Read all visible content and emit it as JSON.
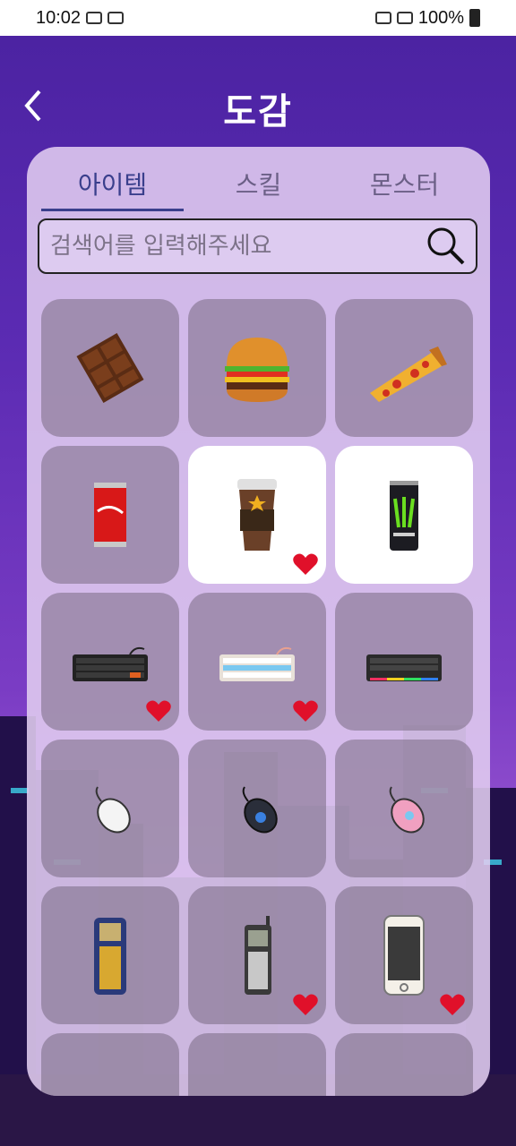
{
  "status_bar": {
    "time": "10:02",
    "battery": "100%"
  },
  "header": {
    "title": "도감",
    "back_icon": "chevron-left-icon"
  },
  "tabs": [
    {
      "label": "아이템",
      "active": true
    },
    {
      "label": "스킬",
      "active": false
    },
    {
      "label": "몬스터",
      "active": false
    }
  ],
  "search": {
    "placeholder": "검색어를 입력해주세요",
    "value": ""
  },
  "items": [
    {
      "icon": "chocolate-bar-icon",
      "owned": false,
      "favorite": false
    },
    {
      "icon": "hamburger-icon",
      "owned": false,
      "favorite": false
    },
    {
      "icon": "pizza-slice-icon",
      "owned": false,
      "favorite": false
    },
    {
      "icon": "cola-can-icon",
      "owned": false,
      "favorite": false
    },
    {
      "icon": "coffee-cup-icon",
      "owned": true,
      "favorite": true
    },
    {
      "icon": "energy-drink-can-icon",
      "owned": true,
      "favorite": false
    },
    {
      "icon": "black-keyboard-icon",
      "owned": false,
      "favorite": true
    },
    {
      "icon": "white-blue-keyboard-icon",
      "owned": false,
      "favorite": true
    },
    {
      "icon": "rgb-keyboard-icon",
      "owned": false,
      "favorite": false
    },
    {
      "icon": "white-mouse-icon",
      "owned": false,
      "favorite": false
    },
    {
      "icon": "blue-gaming-mouse-icon",
      "owned": false,
      "favorite": false
    },
    {
      "icon": "pink-mouse-icon",
      "owned": false,
      "favorite": false
    },
    {
      "icon": "retro-phone-icon",
      "owned": false,
      "favorite": false
    },
    {
      "icon": "flip-cellphone-icon",
      "owned": false,
      "favorite": true
    },
    {
      "icon": "smartphone-icon",
      "owned": false,
      "favorite": true
    },
    {
      "icon": "item-icon",
      "owned": false,
      "favorite": false
    },
    {
      "icon": "item-icon",
      "owned": false,
      "favorite": false
    },
    {
      "icon": "item-icon",
      "owned": false,
      "favorite": false
    }
  ],
  "colors": {
    "heart": "#e0102a",
    "tab_active": "#3a3f8c",
    "card_locked": "#786982",
    "card_owned": "#ffffff"
  }
}
